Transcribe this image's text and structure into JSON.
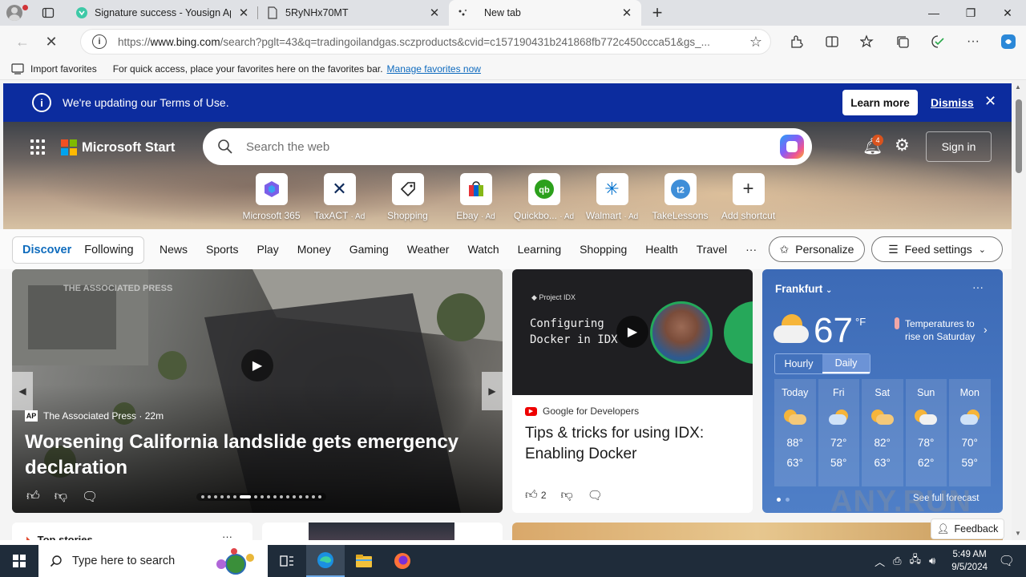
{
  "browser": {
    "tabs": [
      {
        "title": "Signature success - Yousign App",
        "favicon": "yousign-icon",
        "active": false
      },
      {
        "title": "5RyNHx70MT",
        "favicon": "document-icon",
        "active": false
      },
      {
        "title": "New tab",
        "favicon": "loading-icon",
        "active": true
      }
    ],
    "url_prefix": "https://",
    "url_domain": "www.bing.com",
    "url_rest": "/search?pglt=43&q=tradingoilandgas.sczproducts&cvid=c157190431b241868fb772c450ccca51&gs_...",
    "favorites_bar": {
      "import_label": "Import favorites",
      "hint": "For quick access, place your favorites here on the favorites bar.",
      "manage_link": "Manage favorites now"
    }
  },
  "terms_banner": {
    "message": "We're updating our Terms of Use.",
    "learn_more": "Learn more",
    "dismiss": "Dismiss"
  },
  "header": {
    "brand": "Microsoft Start",
    "search_placeholder": "Search the web",
    "notification_count": "4",
    "sign_in": "Sign in"
  },
  "shortcuts": [
    {
      "label": "Microsoft 365",
      "ad": "",
      "icon": "m365-icon"
    },
    {
      "label": "TaxACT",
      "ad": "· Ad",
      "icon": "taxact-icon"
    },
    {
      "label": "Shopping",
      "ad": "",
      "icon": "shopping-tag-icon"
    },
    {
      "label": "Ebay",
      "ad": "· Ad",
      "icon": "ebay-icon"
    },
    {
      "label": "Quickbo...",
      "ad": "· Ad",
      "icon": "quickbooks-icon"
    },
    {
      "label": "Walmart",
      "ad": "· Ad",
      "icon": "walmart-icon"
    },
    {
      "label": "TakeLessons",
      "ad": "",
      "icon": "takelessons-icon"
    },
    {
      "label": "Add shortcut",
      "ad": "",
      "icon": "plus-icon"
    }
  ],
  "feed_nav": {
    "discover": "Discover",
    "following": "Following",
    "links": [
      "News",
      "Sports",
      "Play",
      "Money",
      "Gaming",
      "Weather",
      "Watch",
      "Learning",
      "Shopping",
      "Health",
      "Travel"
    ],
    "more": "···",
    "personalize": "Personalize",
    "feed_settings": "Feed settings"
  },
  "hero_card": {
    "watermark": "THE ASSOCIATED PRESS",
    "source_logo": "AP",
    "source": "The Associated Press · 22m",
    "title": "Worsening California landslide gets emergency declaration"
  },
  "idx_card": {
    "brand_label": "Project IDX",
    "code_line1": "Configuring",
    "code_line2": "Docker in IDX",
    "source": "Google for Developers",
    "title": "Tips & tricks for using IDX: Enabling Docker",
    "likes": "2"
  },
  "weather": {
    "city": "Frankfurt",
    "temp": "67",
    "unit": "°F",
    "note": "Temperatures to rise on Saturday",
    "tab_hourly": "Hourly",
    "tab_daily": "Daily",
    "days": [
      {
        "name": "Today",
        "hi": "88°",
        "lo": "63°",
        "icon": "partly-sunny-icon"
      },
      {
        "name": "Fri",
        "hi": "72°",
        "lo": "58°",
        "icon": "rain-cloud-icon"
      },
      {
        "name": "Sat",
        "hi": "82°",
        "lo": "63°",
        "icon": "partly-sunny-icon"
      },
      {
        "name": "Sun",
        "hi": "78°",
        "lo": "62°",
        "icon": "partly-sunny-icon"
      },
      {
        "name": "Mon",
        "hi": "70°",
        "lo": "59°",
        "icon": "rain-cloud-icon"
      }
    ],
    "full_forecast": "See full forecast"
  },
  "bottom": {
    "top_stories": "Top stories",
    "feedback": "Feedback"
  },
  "watermark": "ANY.RUN",
  "taskbar": {
    "search_placeholder": "Type here to search",
    "time": "5:49 AM",
    "date": "9/5/2024"
  },
  "colors": {
    "banner": "#0c2c9e",
    "accent": "#0f6cbd",
    "weather_bg": "#3c6ab6"
  }
}
